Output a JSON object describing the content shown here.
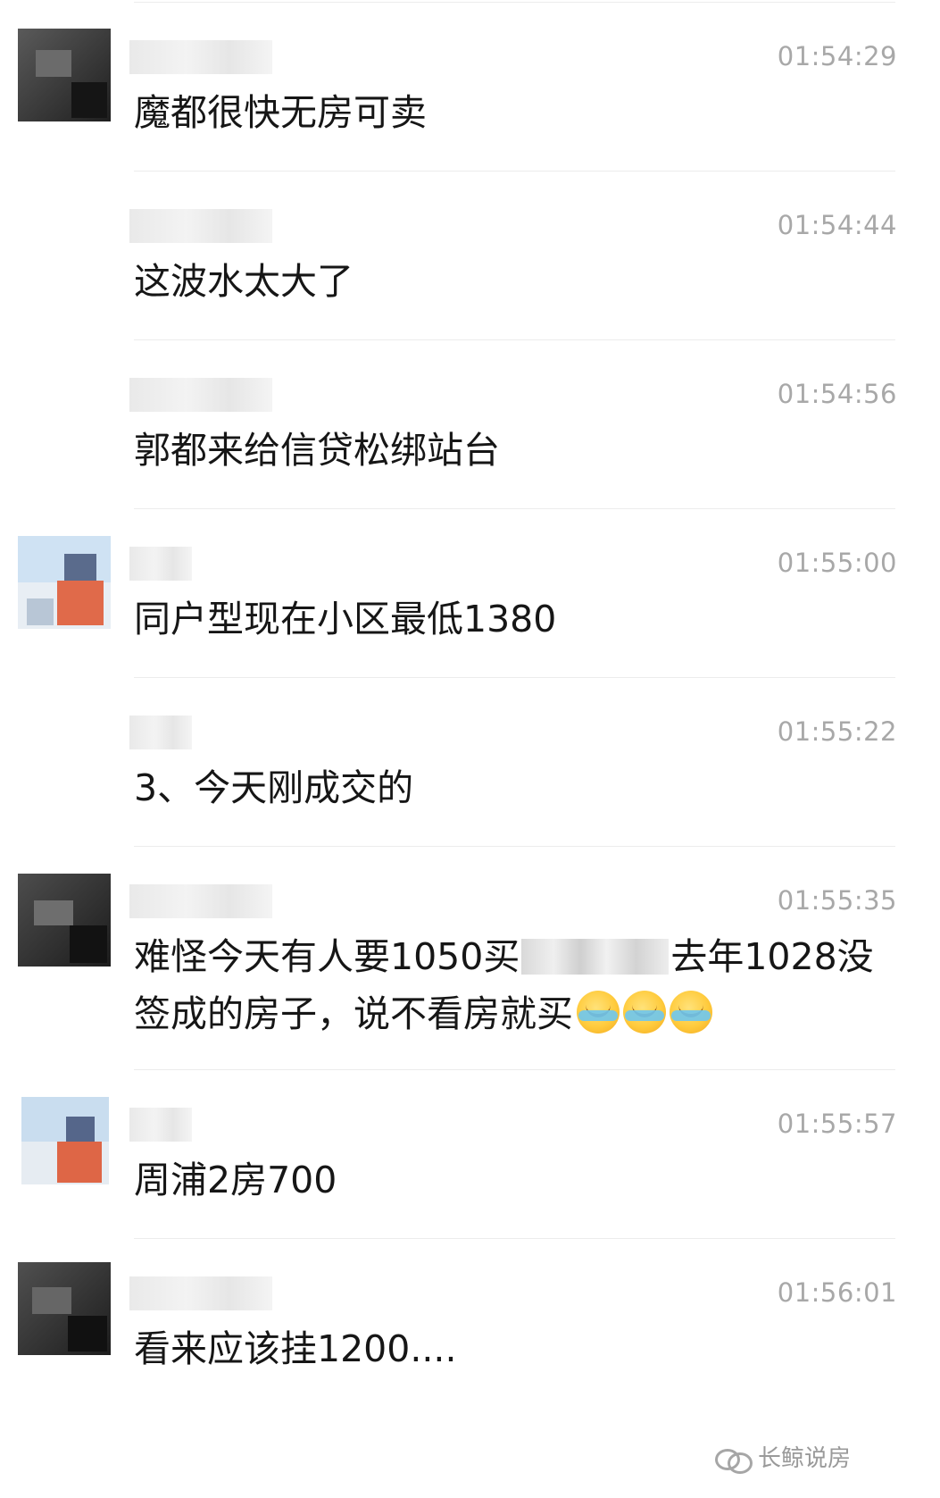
{
  "messages": [
    {
      "sender": "",
      "time": "01:54:29",
      "text": "魔都很快无房可卖",
      "avatar": "dark"
    },
    {
      "sender": "",
      "time": "01:54:44",
      "text": "这波水太大了",
      "avatar": "none"
    },
    {
      "sender": "",
      "time": "01:54:56",
      "text": "郭都来给信贷松绑站台",
      "avatar": "none"
    },
    {
      "sender": "",
      "time": "01:55:00",
      "text": "同户型现在小区最低1380",
      "avatar": "beach"
    },
    {
      "sender": "",
      "time": "01:55:22",
      "text": "3、今天刚成交的",
      "avatar": "none"
    },
    {
      "sender": "",
      "time": "01:55:35",
      "text_part1": "难怪今天有人要1050买",
      "text_part2": "去年1028没",
      "text_line2": "签成的房子，说不看房就买",
      "avatar": "dark"
    },
    {
      "sender": "",
      "time": "01:55:57",
      "text": "周浦2房700",
      "avatar": "beach"
    },
    {
      "sender": "",
      "time": "01:56:01",
      "text": "看来应该挂1200....",
      "avatar": "dark"
    }
  ],
  "emoji": {
    "name": "crying-laughing-emoji",
    "count": 3
  },
  "watermark": {
    "text": "长鲸说房",
    "icon": "wechat-channel-icon"
  }
}
